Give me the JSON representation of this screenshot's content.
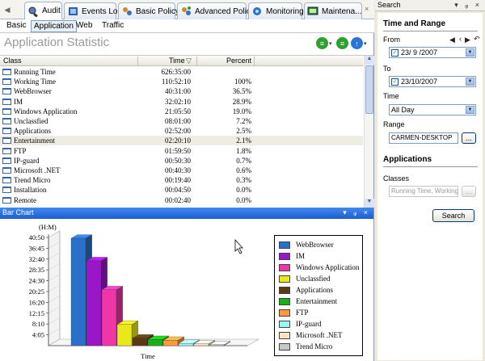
{
  "tabs": [
    {
      "label": "Audit",
      "icon": "audit-icon"
    },
    {
      "label": "Events Log",
      "icon": "events-log-icon"
    },
    {
      "label": "Basic Policy",
      "icon": "basic-policy-icon"
    },
    {
      "label": "Advanced Policy",
      "icon": "advanced-policy-icon"
    },
    {
      "label": "Monitoring",
      "icon": "monitoring-icon"
    },
    {
      "label": "Maintena...",
      "icon": "maintenance-icon"
    }
  ],
  "subtabs": [
    "Basic",
    "Application",
    "Web",
    "Traffic"
  ],
  "app_title": "Application Statistic",
  "table": {
    "headers": {
      "class": "Class",
      "time": "Time",
      "percent": "Percent"
    },
    "rows": [
      {
        "name": "Running Time",
        "time": "626:35:00",
        "percent": ""
      },
      {
        "name": "Working Time",
        "time": "110:52:10",
        "percent": "100%"
      },
      {
        "name": "WebBrowser",
        "time": "40:31:00",
        "percent": "36.5%"
      },
      {
        "name": "IM",
        "time": "32:02:10",
        "percent": "28.9%"
      },
      {
        "name": "Windows Application",
        "time": "21:05:50",
        "percent": "19.0%"
      },
      {
        "name": "Unclassfied",
        "time": "08:01:00",
        "percent": "7.2%"
      },
      {
        "name": "Applications",
        "time": "02:52:00",
        "percent": "2.5%"
      },
      {
        "name": "Entertainment",
        "time": "02:20:10",
        "percent": "2.1%"
      },
      {
        "name": "FTP",
        "time": "01:59:50",
        "percent": "1.8%"
      },
      {
        "name": "IP-guard",
        "time": "00:50:30",
        "percent": "0.7%"
      },
      {
        "name": "Microsoft .NET",
        "time": "00:40:30",
        "percent": "0.6%"
      },
      {
        "name": "Trend Micro",
        "time": "00:19:40",
        "percent": "0.3%"
      },
      {
        "name": "Installation",
        "time": "00:04:50",
        "percent": "0.0%"
      },
      {
        "name": "Remote",
        "time": "00:02:40",
        "percent": "0.0%"
      }
    ]
  },
  "bar_chart_panel": {
    "title": "Bar Chart",
    "controls": "▾ ᵩ ×"
  },
  "chart_data": {
    "type": "bar",
    "ylabel": "(H:M)",
    "xlabel": "Time",
    "yticks": [
      "40:50",
      "36:45",
      "32:40",
      "28:35",
      "24:30",
      "20:25",
      "16:20",
      "12:15",
      "8:10",
      "4:05"
    ],
    "ylim_minutes": [
      0,
      2450
    ],
    "categories": [
      "WebBrowser",
      "IM",
      "Windows Application",
      "Unclassfied",
      "Applications",
      "Entertainment",
      "FTP",
      "IP-guard",
      "Microsoft .NET",
      "Trend Micro"
    ],
    "values_minutes": [
      2431,
      1922,
      1266,
      481,
      172,
      140,
      120,
      51,
      41,
      20
    ],
    "colors": [
      "#2a6fc9",
      "#9a16c9",
      "#f035a8",
      "#e8e81a",
      "#5a3a12",
      "#18b018",
      "#ff9a3a",
      "#9ef4f4",
      "#fde3c0",
      "#c8c8c8"
    ]
  },
  "search": {
    "title": "Search",
    "title_controls": "▾ ᵩ ×",
    "section_time": "Time and Range",
    "from_label": "From",
    "from_value": "23/ 9 /2007",
    "to_label": "To",
    "to_value": "23/10/2007",
    "time_label": "Time",
    "time_value": "All Day",
    "range_label": "Range",
    "range_value": "CARMEN-DESKTOP",
    "browse_label": "...",
    "section_apps": "Applications",
    "classes_label": "Classes",
    "classes_value": "Running Time, Working",
    "classes_browse": "...",
    "search_button": "Search"
  }
}
